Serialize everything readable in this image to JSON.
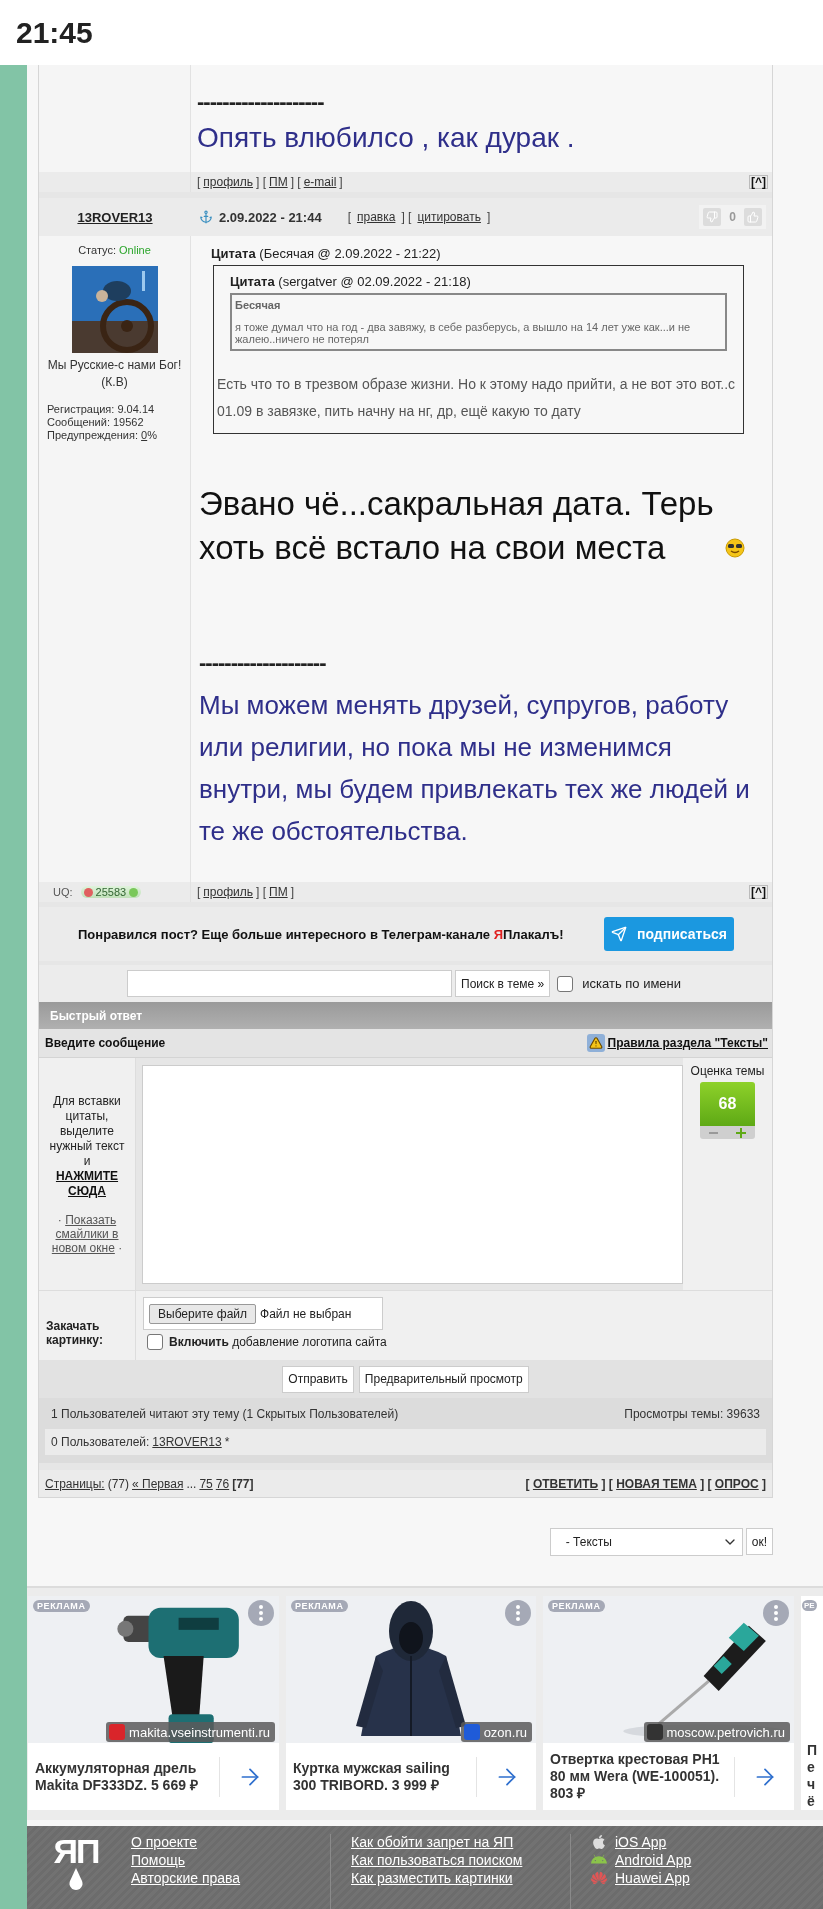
{
  "status_bar": {
    "time": "21:45"
  },
  "previous_post": {
    "separator": "--------------------",
    "signature": "Опять влюбилсо , как дурак .",
    "links": [
      {
        "kind": "text",
        "text": "["
      },
      {
        "kind": "link",
        "text": "профиль"
      },
      {
        "kind": "text",
        "text": "] ["
      },
      {
        "kind": "link",
        "text": "ПМ"
      },
      {
        "kind": "text",
        "text": "] ["
      },
      {
        "kind": "link",
        "text": "e-mail"
      },
      {
        "kind": "text",
        "text": "]"
      }
    ],
    "top_link": "[^]"
  },
  "post": {
    "author": "13ROVER13",
    "status_label": "Статус:",
    "status": "Online",
    "avatar_caption": "Мы Русские-с нами Бог! (К.В)",
    "stats": [
      [
        {
          "kind": "text",
          "text": "Регистрация: 9.04.14"
        }
      ],
      [
        {
          "kind": "text",
          "text": "Сообщений: 19562"
        }
      ],
      [
        {
          "kind": "text",
          "text": "Предупреждения: "
        },
        {
          "kind": "link",
          "text": "0"
        },
        {
          "kind": "text",
          "text": "%"
        }
      ]
    ],
    "date": "2.09.2022 - 21:44",
    "actions": [
      {
        "kind": "text",
        "text": "["
      },
      {
        "kind": "link",
        "text": "правка"
      },
      {
        "kind": "text",
        "text": "] ["
      },
      {
        "kind": "link",
        "text": "цитировать"
      },
      {
        "kind": "text",
        "text": "]"
      }
    ],
    "rating": "0",
    "quote": {
      "header": "**Цитата** (Бесячая @ 2.09.2022 - 21:22)",
      "nested_header": "**Цитата** (sergatver @ 02.09.2022 - 21:18)",
      "inner_author": "Бесячая",
      "inner_text": "я тоже думал что на год - два завяжу, в себе разберусь, а  вышло на 14 лет уже как...и не жалею..ничего не потерял",
      "text": "Есть что то в трезвом образе жизни. Но к этому надо прийти, а не вот это вот..с 01.09 в завязке, пить начну на нг, др, ещё какую то дату"
    },
    "body": "Эвано чё...сакральная дата. Терь хоть всё встало на свои места",
    "separator": "--------------------",
    "signature": "Мы можем менять друзей, супругов, работу или религии, но пока мы не изменимся внутри, мы будем привлекать тех же людей и те же обстоятельства.",
    "uq_label": "UQ:",
    "uq_value": "25583",
    "links": [
      {
        "kind": "text",
        "text": "["
      },
      {
        "kind": "link",
        "text": "профиль"
      },
      {
        "kind": "text",
        "text": "] ["
      },
      {
        "kind": "link",
        "text": "ПМ"
      },
      {
        "kind": "text",
        "text": "]"
      }
    ],
    "top_link": "[^]"
  },
  "telegram": {
    "before": "Понравился пост? Еще больше интересного в Телеграм-канале ",
    "accent": "Я",
    "after": "Плакалъ!",
    "button": "подписаться"
  },
  "search": {
    "button": "Поиск в теме »",
    "checkbox_label": "искать по имени",
    "checked": false
  },
  "quick_reply": {
    "title": "Быстрый ответ",
    "prompt": "Введите сообщение",
    "rules_link": "Правила раздела \"Тексты\"",
    "hint": "Для вставки цитаты, выделите нужный текст и",
    "hint_link": "НАЖМИТЕ СЮДА",
    "smilies": [
      {
        "kind": "text",
        "text": "·"
      },
      {
        "kind": "link",
        "text": "Показать смайлики в новом окне"
      },
      {
        "kind": "text",
        "text": "·"
      }
    ],
    "rating_label": "Оценка темы",
    "rating": "68",
    "upload_label": "Закачать картинку:",
    "file_button": "Выберите файл",
    "file_status": "Файл не выбран",
    "logo_option": {
      "text": "**Включить** добавление логотипа сайта",
      "checked": false
    },
    "buttons": [
      "Отправить",
      "Предварительный просмотр"
    ]
  },
  "viewers": {
    "reading": "1 Пользователей читают эту тему (1 Скрытых Пользователей)",
    "views": "Просмотры темы: 39633",
    "users": [
      {
        "kind": "text",
        "text": "0 Пользователей:"
      },
      {
        "kind": "link",
        "text": "13ROVER13"
      },
      {
        "kind": "text",
        "text": "*"
      }
    ]
  },
  "pagination": [
    {
      "kind": "link",
      "text": "Страницы:"
    },
    {
      "kind": "text",
      "text": "(77)"
    },
    {
      "kind": "link",
      "text": "« Первая"
    },
    {
      "kind": "text",
      "text": "..."
    },
    {
      "kind": "link",
      "text": "75"
    },
    {
      "kind": "link",
      "text": "76"
    },
    {
      "kind": "current",
      "text": "[77]"
    }
  ],
  "topic_actions": [
    {
      "kind": "strong",
      "text": "[ "
    },
    {
      "kind": "strong_link",
      "text": "ОТВЕТИТЬ"
    },
    {
      "kind": "strong",
      "text": " ] [ "
    },
    {
      "kind": "strong_link",
      "text": "НОВАЯ ТЕМА"
    },
    {
      "kind": "strong",
      "text": " ] [ "
    },
    {
      "kind": "strong_link",
      "text": "ОПРОС"
    },
    {
      "kind": "strong",
      "text": " ]"
    }
  ],
  "forum_select": {
    "value": "- Тексты",
    "button": "ок!"
  },
  "ads": [
    {
      "label": "РЕКЛАМА",
      "kind": "drill",
      "domain": "makita.vseinstrumenti.ru",
      "title": "Аккумуляторная дрель Makita DF333DZ. 5 669 ₽"
    },
    {
      "label": "РЕКЛАМА",
      "kind": "jacket",
      "domain": "ozon.ru",
      "title": "Куртка мужская sailing 300 TRIBORD. 3 999 ₽"
    },
    {
      "label": "РЕКЛАМА",
      "kind": "screwdriver",
      "domain": "moscow.petrovich.ru",
      "title": "Отвертка крестовая PH1 80 мм Wera (WE-100051). 803 ₽"
    },
    {
      "label": "РЕ",
      "kind": "partial",
      "title": "Пе чё"
    }
  ],
  "footer": {
    "logo": "ЯП",
    "columns": [
      [
        {
          "label": "О проекте"
        },
        {
          "label": "Помощь"
        },
        {
          "label": "Авторские права"
        }
      ],
      [
        {
          "label": "Как обойти запрет на ЯП"
        },
        {
          "label": "Как пользоваться поиском"
        },
        {
          "label": "Как разместить картинки"
        }
      ],
      [
        {
          "label": "iOS App"
        },
        {
          "label": "Android App"
        },
        {
          "label": "Huawei App"
        }
      ]
    ]
  }
}
